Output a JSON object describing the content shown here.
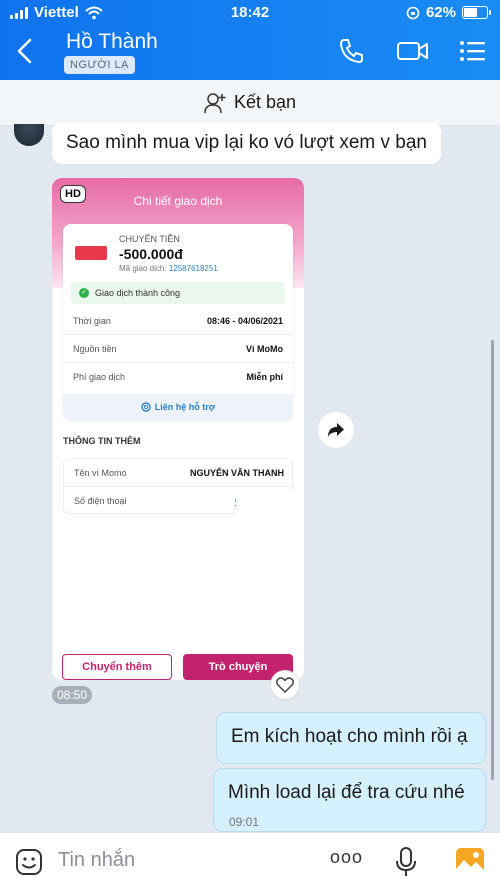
{
  "status_bar": {
    "carrier": "Viettel",
    "time": "18:42",
    "battery": "62%",
    "battery_level": 0.62
  },
  "header": {
    "contact_name": "Hồ Thành",
    "badge": "NGƯỜI LẠ"
  },
  "friend_bar": {
    "label": "Kết bạn"
  },
  "messages": {
    "incoming_text": "Sao mình mua vip lại ko vó lượt xem v bạn",
    "image_time": "08:50",
    "outgoing_1": "Em kích hoạt cho mình rồi ạ",
    "outgoing_2": "Mình load lại để tra cứu nhé",
    "outgoing_2_time": "09:01"
  },
  "momo": {
    "hd": "HD",
    "title": "Chi tiết giao dịch",
    "transfer_label": "CHUYỂN TIỀN",
    "amount": "-500.000đ",
    "txid_label": "Mã giao dịch:",
    "txid": "12587618251",
    "status": "Giao dịch thành công",
    "rows": [
      {
        "label": "Thời gian",
        "value": "08:46 - 04/06/2021"
      },
      {
        "label": "Nguồn tiền",
        "value": "Ví MoMo"
      },
      {
        "label": "Phí giao dịch",
        "value": "Miễn phí"
      }
    ],
    "support": "Liên hệ hỗ trợ",
    "more_title": "THÔNG TIN THÊM",
    "wallet_label": "Tên ví Momo",
    "wallet_name": "NGUYỄN VĂN THANH",
    "phone_label": "Số điện thoại",
    "phone_value": "0",
    "btn_more": "Chuyển thêm",
    "btn_chat": "Trò chuyện"
  },
  "input": {
    "placeholder": "Tin nhắn",
    "more": "ooo"
  },
  "colors": {
    "header": "#0f73ee",
    "momo_pink": "#c3236e",
    "outgoing_bubble": "#d5f1ff"
  }
}
